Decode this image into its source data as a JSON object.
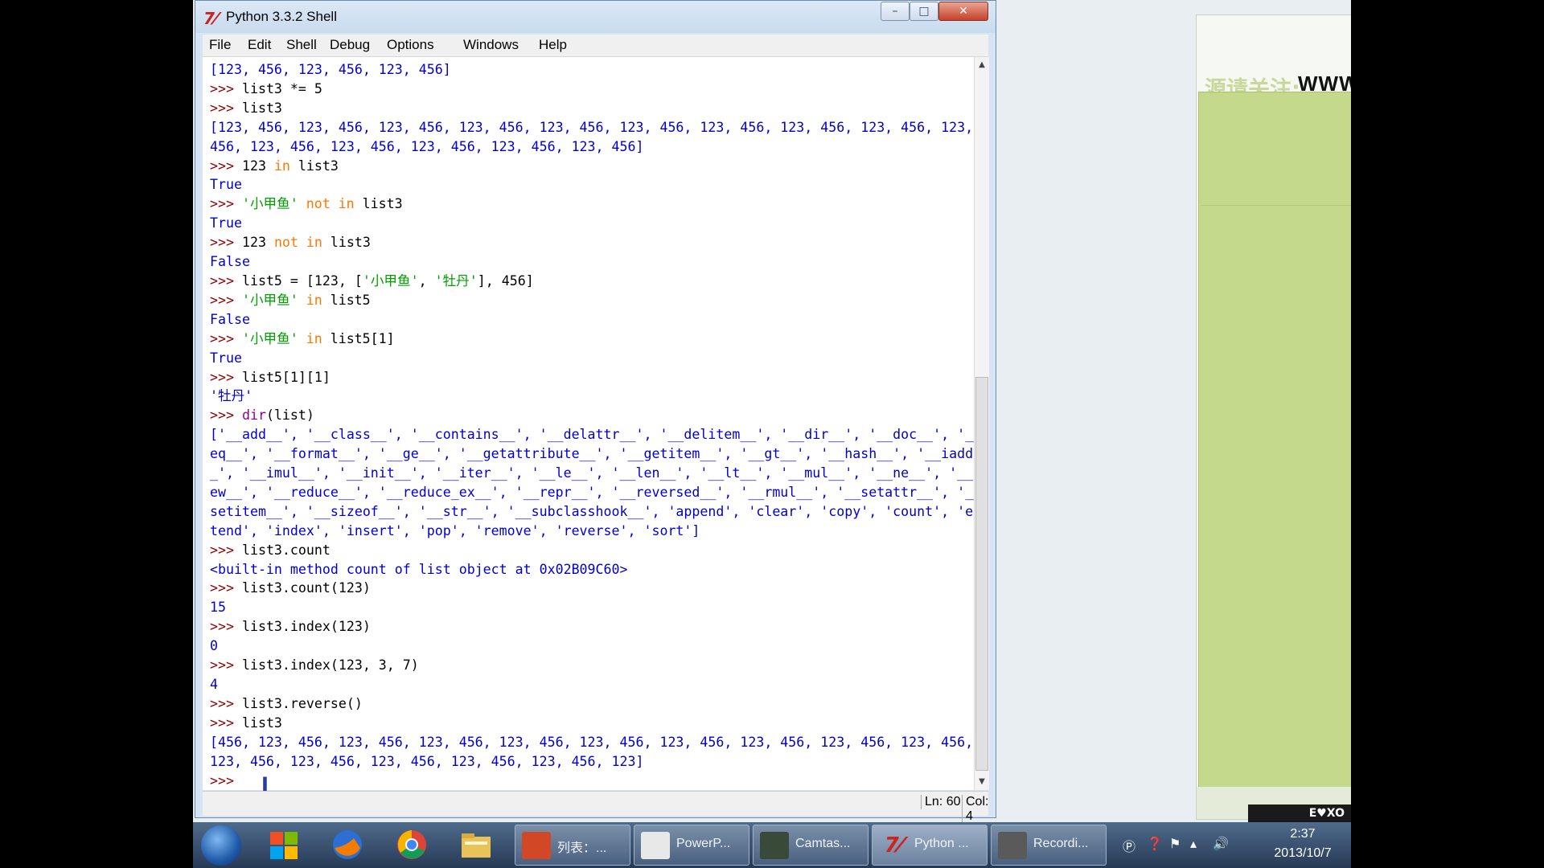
{
  "window": {
    "title": "Python 3.3.2 Shell"
  },
  "menu": [
    "File",
    "Edit",
    "Shell",
    "Debug",
    "Options",
    "Windows",
    "Help"
  ],
  "status": {
    "line": "Ln: 60",
    "col": "Col: 4"
  },
  "background": {
    "banner_cn": "源请关注:",
    "banner_url": "WWW.FISHC.COM",
    "recorder_badge": "E♥XO"
  },
  "taskbar": {
    "buttons": [
      {
        "label": "列表：..."
      },
      {
        "label": "PowerP..."
      },
      {
        "label": "Camtas..."
      },
      {
        "label": "Python ..."
      },
      {
        "label": "Recordi..."
      }
    ],
    "clock_time": "2:37",
    "clock_date": "2013/10/7"
  },
  "shell_lines": [
    [
      {
        "t": "[123, 456, 123, 456, 123, 456]",
        "c": "out"
      }
    ],
    [
      {
        "t": ">>> ",
        "c": "prm"
      },
      {
        "t": "list3 *= 5",
        "c": ""
      }
    ],
    [
      {
        "t": ">>> ",
        "c": "prm"
      },
      {
        "t": "list3",
        "c": ""
      }
    ],
    [
      {
        "t": "[123, 456, 123, 456, 123, 456, 123, 456, 123, 456, 123, 456, 123, 456, 123, 456, 123, 456, 123,",
        "c": "out"
      }
    ],
    [
      {
        "t": "456, 123, 456, 123, 456, 123, 456, 123, 456, 123, 456]",
        "c": "out"
      }
    ],
    [
      {
        "t": ">>> ",
        "c": "prm"
      },
      {
        "t": "123 ",
        "c": ""
      },
      {
        "t": "in",
        "c": "kw"
      },
      {
        "t": " list3",
        "c": ""
      }
    ],
    [
      {
        "t": "True",
        "c": "out"
      }
    ],
    [
      {
        "t": ">>> ",
        "c": "prm"
      },
      {
        "t": "'小甲鱼'",
        "c": "str"
      },
      {
        "t": " ",
        "c": ""
      },
      {
        "t": "not in",
        "c": "kw"
      },
      {
        "t": " list3",
        "c": ""
      }
    ],
    [
      {
        "t": "True",
        "c": "out"
      }
    ],
    [
      {
        "t": ">>> ",
        "c": "prm"
      },
      {
        "t": "123 ",
        "c": ""
      },
      {
        "t": "not in",
        "c": "kw"
      },
      {
        "t": " list3",
        "c": ""
      }
    ],
    [
      {
        "t": "False",
        "c": "out"
      }
    ],
    [
      {
        "t": ">>> ",
        "c": "prm"
      },
      {
        "t": "list5 = [123, [",
        "c": ""
      },
      {
        "t": "'小甲鱼'",
        "c": "str"
      },
      {
        "t": ", ",
        "c": ""
      },
      {
        "t": "'牡丹'",
        "c": "str"
      },
      {
        "t": "], 456]",
        "c": ""
      }
    ],
    [
      {
        "t": ">>> ",
        "c": "prm"
      },
      {
        "t": "'小甲鱼'",
        "c": "str"
      },
      {
        "t": " ",
        "c": ""
      },
      {
        "t": "in",
        "c": "kw"
      },
      {
        "t": " list5",
        "c": ""
      }
    ],
    [
      {
        "t": "False",
        "c": "out"
      }
    ],
    [
      {
        "t": ">>> ",
        "c": "prm"
      },
      {
        "t": "'小甲鱼'",
        "c": "str"
      },
      {
        "t": " ",
        "c": ""
      },
      {
        "t": "in",
        "c": "kw"
      },
      {
        "t": " list5[1]",
        "c": ""
      }
    ],
    [
      {
        "t": "True",
        "c": "out"
      }
    ],
    [
      {
        "t": ">>> ",
        "c": "prm"
      },
      {
        "t": "list5[1][1]",
        "c": ""
      }
    ],
    [
      {
        "t": "'牡丹'",
        "c": "out"
      }
    ],
    [
      {
        "t": ">>> ",
        "c": "prm"
      },
      {
        "t": "dir",
        "c": "bi"
      },
      {
        "t": "(list)",
        "c": ""
      }
    ],
    [
      {
        "t": "['__add__', '__class__', '__contains__', '__delattr__', '__delitem__', '__dir__', '__doc__', '__",
        "c": "out"
      }
    ],
    [
      {
        "t": "eq__', '__format__', '__ge__', '__getattribute__', '__getitem__', '__gt__', '__hash__', '__iadd",
        "c": "out"
      }
    ],
    [
      {
        "t": "_', '__imul__', '__init__', '__iter__', '__le__', '__len__', '__lt__', '__mul__', '__ne__', '__n",
        "c": "out"
      }
    ],
    [
      {
        "t": "ew__', '__reduce__', '__reduce_ex__', '__repr__', '__reversed__', '__rmul__', '__setattr__', '__",
        "c": "out"
      }
    ],
    [
      {
        "t": "setitem__', '__sizeof__', '__str__', '__subclasshook__', 'append', 'clear', 'copy', 'count', 'ex",
        "c": "out"
      }
    ],
    [
      {
        "t": "tend', 'index', 'insert', 'pop', 'remove', 'reverse', 'sort']",
        "c": "out"
      }
    ],
    [
      {
        "t": ">>> ",
        "c": "prm"
      },
      {
        "t": "list3.count",
        "c": ""
      }
    ],
    [
      {
        "t": "<built-in method count of list object at 0x02B09C60>",
        "c": "out"
      }
    ],
    [
      {
        "t": ">>> ",
        "c": "prm"
      },
      {
        "t": "list3.count(123)",
        "c": ""
      }
    ],
    [
      {
        "t": "15",
        "c": "out"
      }
    ],
    [
      {
        "t": ">>> ",
        "c": "prm"
      },
      {
        "t": "list3.index(123)",
        "c": ""
      }
    ],
    [
      {
        "t": "0",
        "c": "out"
      }
    ],
    [
      {
        "t": ">>> ",
        "c": "prm"
      },
      {
        "t": "list3.index(123, 3, 7)",
        "c": ""
      }
    ],
    [
      {
        "t": "4",
        "c": "out"
      }
    ],
    [
      {
        "t": ">>> ",
        "c": "prm"
      },
      {
        "t": "list3.reverse()",
        "c": ""
      }
    ],
    [
      {
        "t": ">>> ",
        "c": "prm"
      },
      {
        "t": "list3",
        "c": ""
      }
    ],
    [
      {
        "t": "[456, 123, 456, 123, 456, 123, 456, 123, 456, 123, 456, 123, 456, 123, 456, 123, 456, 123, 456,",
        "c": "out"
      }
    ],
    [
      {
        "t": "123, 456, 123, 456, 123, 456, 123, 456, 123, 456, 123]",
        "c": "out"
      }
    ],
    [
      {
        "t": ">>> ",
        "c": "prm"
      }
    ]
  ]
}
